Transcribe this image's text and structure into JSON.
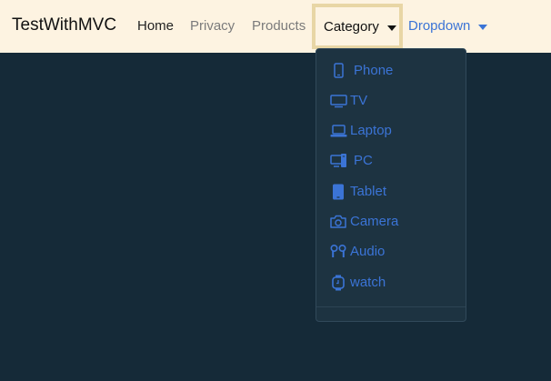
{
  "navbar": {
    "brand": "TestWithMVC",
    "links": {
      "home": "Home",
      "privacy": "Privacy",
      "products": "Products",
      "category": "Category",
      "dropdown": "Dropdown"
    }
  },
  "category_menu": {
    "items": [
      {
        "label": "Phone",
        "icon": "phone-icon"
      },
      {
        "label": "TV",
        "icon": "tv-icon"
      },
      {
        "label": "Laptop",
        "icon": "laptop-icon"
      },
      {
        "label": "PC",
        "icon": "pc-icon"
      },
      {
        "label": "Tablet",
        "icon": "tablet-icon"
      },
      {
        "label": "Camera",
        "icon": "camera-icon"
      },
      {
        "label": "Audio",
        "icon": "earbuds-icon"
      },
      {
        "label": "watch",
        "icon": "watch-icon"
      }
    ]
  },
  "colors": {
    "page_background": "#152a38",
    "navbar_background": "#fdf3e1",
    "link_accent": "#3b74d6",
    "menu_background": "#1d3341",
    "active_outline": "#e8d6a5"
  }
}
